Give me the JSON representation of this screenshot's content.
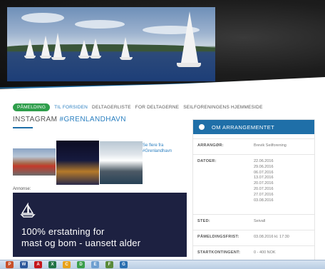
{
  "nav": {
    "signup": "PÅMELDING",
    "items": [
      "TIL FORSIDEN",
      "DELTAGERLISTE",
      "FOR DELTAGERNE",
      "SEILFORENINGENS HJEMMESIDE"
    ]
  },
  "instagram": {
    "title_prefix": "INSTAGRAM ",
    "hashtag": "#GRENLANDHAVN",
    "see_more": "Se flere fra #Grenlandhavn"
  },
  "ad": {
    "label": "Annonse:",
    "line1": "100% erstatning for",
    "line2": "mast og bom - uansett alder"
  },
  "event_panel": {
    "title": "OM ARRANGEMENTET",
    "organizer_label": "ARRANGØR:",
    "organizer": "Brevik Seilforening",
    "dates_label": "DATOER:",
    "dates": [
      "22.06.2016",
      "29.06.2016",
      "06.07.2016",
      "13.07.2016",
      "20.07.2016",
      "20.07.2016",
      "27.07.2016",
      "03.08.2016"
    ],
    "place_label": "STED:",
    "place": "Seivall",
    "deadline_label": "PÅMELDINGSFRIST:",
    "deadline": "03.08.2016 kl. 17:30",
    "fee_label": "STARTKONTINGENT:",
    "fee": "0 - 400 NOK"
  },
  "taskbar": {
    "apps": [
      "P",
      "W",
      "A",
      "X",
      "C",
      "D",
      "E",
      "F",
      "G"
    ],
    "colors": [
      "#c8502a",
      "#2b579a",
      "#c4161c",
      "#217346",
      "#e8a21a",
      "#3a9e4a",
      "#6e9fd0",
      "#5a8a3a",
      "#2a6fb0"
    ]
  },
  "colors": {
    "accent": "#1f6fa8",
    "signup_green": "#2e9e4b",
    "ad_bg": "#1d2141"
  }
}
